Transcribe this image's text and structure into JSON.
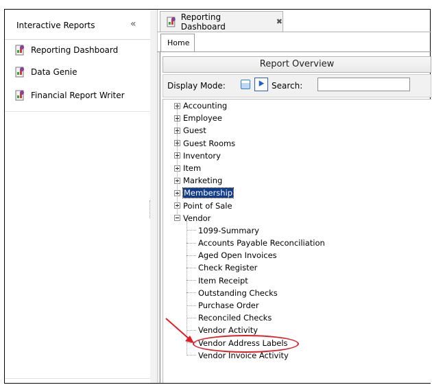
{
  "left_panel": {
    "title": "Interactive Reports",
    "collapse_glyph": "«",
    "items": [
      {
        "label": "Reporting Dashboard",
        "icon": "report-icon"
      },
      {
        "label": "Data Genie",
        "icon": "report-icon"
      },
      {
        "label": "Financial Report Writer",
        "icon": "report-icon"
      }
    ]
  },
  "tab": {
    "label": "Reporting Dashboard",
    "close_glyph": "✖"
  },
  "subtab": {
    "label": "Home"
  },
  "overview": {
    "title": "Report Overview"
  },
  "toolbar": {
    "display_mode_label": "Display Mode:",
    "go_glyph": "⯈",
    "search_label": "Search:",
    "search_value": "",
    "search_placeholder": ""
  },
  "tree": {
    "categories": [
      {
        "label": "Accounting",
        "expanded": false,
        "selected": false
      },
      {
        "label": "Employee",
        "expanded": false,
        "selected": false
      },
      {
        "label": "Guest",
        "expanded": false,
        "selected": false
      },
      {
        "label": "Guest Rooms",
        "expanded": false,
        "selected": false
      },
      {
        "label": "Inventory",
        "expanded": false,
        "selected": false
      },
      {
        "label": "Item",
        "expanded": false,
        "selected": false
      },
      {
        "label": "Marketing",
        "expanded": false,
        "selected": false
      },
      {
        "label": "Membership",
        "expanded": false,
        "selected": true
      },
      {
        "label": "Point of Sale",
        "expanded": false,
        "selected": false
      },
      {
        "label": "Vendor",
        "expanded": true,
        "selected": false
      }
    ],
    "vendor_reports": [
      "1099-Summary",
      "Accounts Payable Reconciliation",
      "Aged Open Invoices",
      "Check Register",
      "Item Receipt",
      "Outstanding Checks",
      "Purchase Order",
      "Reconciled Checks",
      "Vendor Activity",
      "Vendor Address Labels",
      "Vendor Invoice Activity"
    ]
  },
  "colors": {
    "annotation": "#e31b23",
    "selection": "#123c8c",
    "accent": "#2d7fd6"
  }
}
